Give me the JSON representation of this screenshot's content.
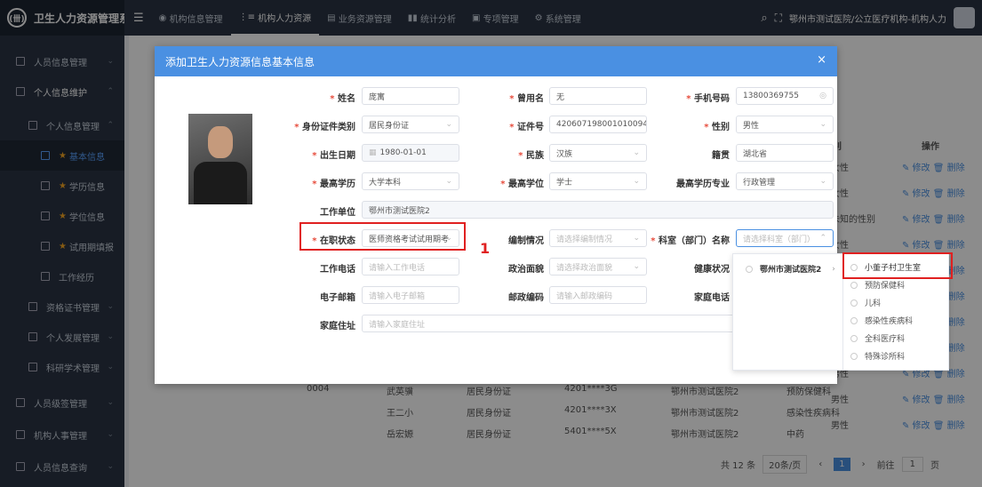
{
  "app": {
    "title": "卫生人力资源管理系统",
    "logo_text": "(卌)"
  },
  "topnav": [
    {
      "label": "机构信息管理"
    },
    {
      "label": "机构人力资源"
    },
    {
      "label": "业务资源管理"
    },
    {
      "label": "统计分析"
    },
    {
      "label": "专项管理"
    },
    {
      "label": "系统管理"
    }
  ],
  "topright": {
    "user": "鄂州市测试医院/公立医疗机构-机构人力"
  },
  "sidebar": {
    "items": [
      {
        "label": "人员信息管理"
      },
      {
        "label": "个人信息维护"
      },
      {
        "label": "个人信息管理"
      },
      {
        "label": "基本信息"
      },
      {
        "label": "学历信息"
      },
      {
        "label": "学位信息"
      },
      {
        "label": "试用期填报"
      },
      {
        "label": "工作经历"
      },
      {
        "label": "资格证书管理"
      },
      {
        "label": "个人发展管理"
      },
      {
        "label": "科研学术管理"
      },
      {
        "label": "人员级签管理"
      },
      {
        "label": "机构人事管理"
      },
      {
        "label": "人员信息查询"
      }
    ]
  },
  "background_table": {
    "headers": {
      "gender": "性别",
      "ops": "操作"
    },
    "gender_col": [
      "女性",
      "女性",
      "未知的性别",
      "女性",
      "女性",
      "女性",
      "女性",
      "女性",
      "男性",
      "男性",
      "男性"
    ],
    "edit": "修改",
    "delete": "删除",
    "rows": [
      {
        "id": "0004",
        "name": "武英骥",
        "idtype": "居民身份证",
        "idno": "4201****3G",
        "org": "鄂州市测试医院2",
        "dept": "预防保健科",
        "gender": "男性"
      },
      {
        "id": "",
        "name": "王二小",
        "idtype": "居民身份证",
        "idno": "4201****3X",
        "org": "鄂州市测试医院2",
        "dept": "感染性疾病科",
        "gender": "男性"
      },
      {
        "id": "",
        "name": "岳宏嫄",
        "idtype": "居民身份证",
        "idno": "5401****5X",
        "org": "鄂州市测试医院2",
        "dept": "中药",
        "gender": "男性"
      }
    ],
    "pagination": {
      "total": "共 12 条",
      "page_size": "20条/页",
      "current": "1",
      "goto": "前往",
      "goto_val": "1",
      "page_unit": "页"
    }
  },
  "modal": {
    "title": "添加卫生人力资源信息基本信息",
    "close": "×",
    "fields": {
      "name": {
        "label": "姓名",
        "value": "庞寓"
      },
      "former_name": {
        "label": "曾用名",
        "value": "无"
      },
      "phone": {
        "label": "手机号码",
        "value": "13800369755"
      },
      "id_type": {
        "label": "身份证件类别",
        "value": "居民身份证"
      },
      "id_no": {
        "label": "证件号",
        "value": "420607198001010094"
      },
      "gender": {
        "label": "性别",
        "value": "男性"
      },
      "birth": {
        "label": "出生日期",
        "value": "1980-01-01"
      },
      "ethnic": {
        "label": "民族",
        "value": "汉族"
      },
      "native": {
        "label": "籍贯",
        "value": "湖北省"
      },
      "education": {
        "label": "最高学历",
        "value": "大学本科"
      },
      "degree": {
        "label": "最高学位",
        "value": "学士"
      },
      "major": {
        "label": "最高学历专业",
        "value": "行政管理"
      },
      "work_unit": {
        "label": "工作单位",
        "value": "鄂州市测试医院2"
      },
      "status": {
        "label": "在职状态",
        "value": "医师资格考试试用期考"
      },
      "staffing": {
        "label": "编制情况",
        "placeholder": "请选择编制情况"
      },
      "dept": {
        "label": "科室（部门）名称",
        "placeholder": "请选择科室（部门）"
      },
      "work_phone": {
        "label": "工作电话",
        "placeholder": "请输入工作电话"
      },
      "politics": {
        "label": "政治面貌",
        "placeholder": "请选择政治面貌"
      },
      "health": {
        "label": "健康状况"
      },
      "email": {
        "label": "电子邮箱",
        "placeholder": "请输入电子邮箱"
      },
      "postcode": {
        "label": "邮政编码",
        "placeholder": "请输入邮政编码"
      },
      "home_phone": {
        "label": "家庭电话"
      },
      "address": {
        "label": "家庭住址",
        "placeholder": "请输入家庭住址"
      }
    },
    "annotation": "1"
  },
  "dept_dropdown": {
    "level1": [
      {
        "label": "鄂州市测试医院2"
      }
    ],
    "level2": [
      {
        "label": "小董子村卫生室"
      },
      {
        "label": "预防保健科"
      },
      {
        "label": "儿科"
      },
      {
        "label": "感染性疾病科"
      },
      {
        "label": "全科医疗科"
      },
      {
        "label": "特殊诊所科"
      }
    ]
  },
  "colors": {
    "accent": "#4a90e2",
    "sidebar_bg": "#2b3444",
    "highlight": "#e02020",
    "required": "#e74c3c"
  }
}
